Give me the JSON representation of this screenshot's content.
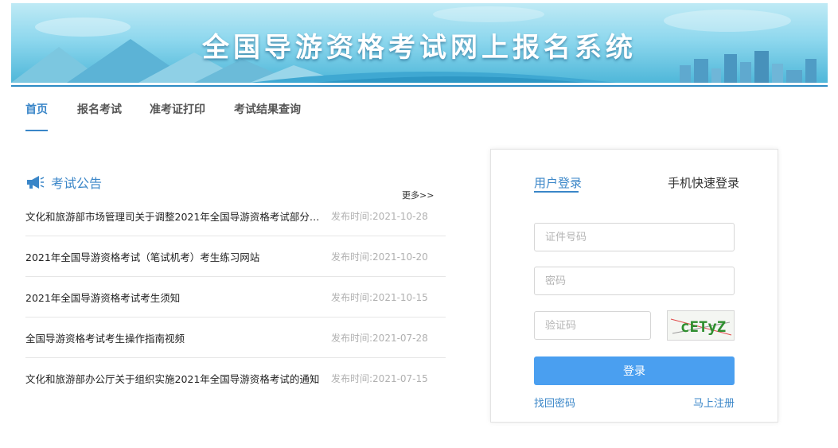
{
  "banner": {
    "title": "全国导游资格考试网上报名系统"
  },
  "nav": {
    "items": [
      {
        "label": "首页",
        "active": true
      },
      {
        "label": "报名考试",
        "active": false
      },
      {
        "label": "准考证打印",
        "active": false
      },
      {
        "label": "考试结果查询",
        "active": false
      }
    ]
  },
  "notices": {
    "title": "考试公告",
    "icon": "megaphone-icon",
    "more_label": "更多>>",
    "items": [
      {
        "text": "文化和旅游部市场管理司关于调整2021年全国导游资格考试部分…",
        "date": "发布时间:2021-10-28"
      },
      {
        "text": "2021年全国导游资格考试（笔试机考）考生练习网站",
        "date": "发布时间:2021-10-20"
      },
      {
        "text": "2021年全国导游资格考试考生须知",
        "date": "发布时间:2021-10-15"
      },
      {
        "text": "全国导游资格考试考生操作指南视频",
        "date": "发布时间:2021-07-28"
      },
      {
        "text": "文化和旅游部办公厅关于组织实施2021年全国导游资格考试的通知",
        "date": "发布时间:2021-07-15"
      }
    ]
  },
  "login": {
    "tab_user": "用户登录",
    "tab_phone": "手机快速登录",
    "id_placeholder": "证件号码",
    "password_placeholder": "密码",
    "code_placeholder": "验证码",
    "captcha_text": "cETyZ",
    "submit_label": "登录",
    "forgot_label": "找回密码",
    "register_label": "马上注册"
  },
  "colors": {
    "accent": "#3a86c8",
    "button": "#4a9ff0",
    "date_gray": "#b0b0b0"
  }
}
